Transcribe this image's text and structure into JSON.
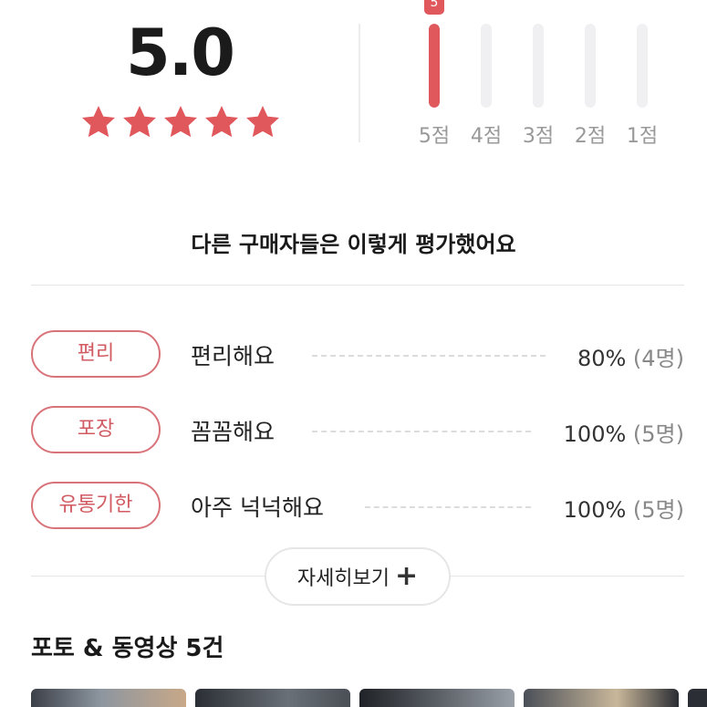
{
  "rating": {
    "score": "5.0",
    "stars_filled": 5,
    "star_color": "#e0575c"
  },
  "distribution": [
    {
      "label": "5점",
      "fraction": 1.0,
      "count": "5"
    },
    {
      "label": "4점",
      "fraction": 0
    },
    {
      "label": "3점",
      "fraction": 0
    },
    {
      "label": "2점",
      "fraction": 0
    },
    {
      "label": "1점",
      "fraction": 0
    }
  ],
  "summary": {
    "title": "다른 구매자들은 이렇게 평가했어요"
  },
  "keywords": [
    {
      "tag": "편리",
      "text": "편리해요",
      "percent": "80%",
      "count": "(4명)"
    },
    {
      "tag": "포장",
      "text": "꼼꼼해요",
      "percent": "100%",
      "count": "(5명)"
    },
    {
      "tag": "유통기한",
      "text": "아주 넉넉해요",
      "percent": "100%",
      "count": "(5명)"
    }
  ],
  "more_button": {
    "label": "자세히보기",
    "icon": "plus-icon"
  },
  "photos": {
    "title": "포토 & 동영상 5건"
  },
  "colors": {
    "accent": "#e0575c",
    "tag_border": "#d9737a"
  }
}
